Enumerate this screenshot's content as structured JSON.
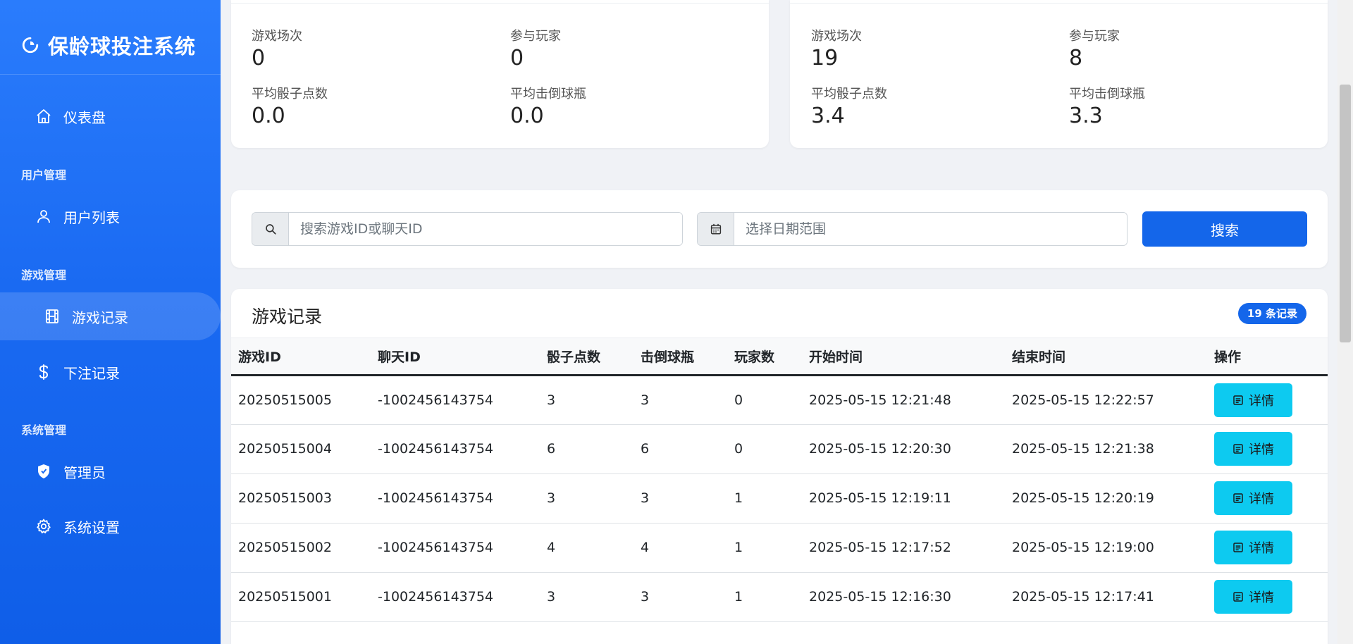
{
  "sidebar": {
    "brand": "保龄球投注系统",
    "items": [
      {
        "label": "仪表盘"
      },
      {
        "label": "用户列表"
      },
      {
        "label": "游戏记录"
      },
      {
        "label": "下注记录"
      },
      {
        "label": "管理员"
      },
      {
        "label": "系统设置"
      }
    ],
    "sections": [
      "用户管理",
      "游戏管理",
      "系统管理"
    ],
    "active_item": "游戏记录"
  },
  "stats": {
    "left": {
      "games_label": "游戏场次",
      "games": "0",
      "players_label": "参与玩家",
      "players": "0",
      "dice_label": "平均骰子点数",
      "dice": "0.0",
      "pins_label": "平均击倒球瓶",
      "pins": "0.0"
    },
    "right": {
      "games_label": "游戏场次",
      "games": "19",
      "players_label": "参与玩家",
      "players": "8",
      "dice_label": "平均骰子点数",
      "dice": "3.4",
      "pins_label": "平均击倒球瓶",
      "pins": "3.3"
    }
  },
  "search": {
    "keyword_placeholder": "搜索游戏ID或聊天ID",
    "date_placeholder": "选择日期范围",
    "button": "搜索"
  },
  "records": {
    "title": "游戏记录",
    "count_badge": "19 条记录",
    "columns": [
      "游戏ID",
      "聊天ID",
      "骰子点数",
      "击倒球瓶",
      "玩家数",
      "开始时间",
      "结束时间",
      "操作"
    ],
    "detail_label": "详情",
    "rows": [
      {
        "game_id": "20250515005",
        "chat_id": "-1002456143754",
        "dice": "3",
        "pins": "3",
        "players": "0",
        "start": "2025-05-15 12:21:48",
        "end": "2025-05-15 12:22:57"
      },
      {
        "game_id": "20250515004",
        "chat_id": "-1002456143754",
        "dice": "6",
        "pins": "6",
        "players": "0",
        "start": "2025-05-15 12:20:30",
        "end": "2025-05-15 12:21:38"
      },
      {
        "game_id": "20250515003",
        "chat_id": "-1002456143754",
        "dice": "3",
        "pins": "3",
        "players": "1",
        "start": "2025-05-15 12:19:11",
        "end": "2025-05-15 12:20:19"
      },
      {
        "game_id": "20250515002",
        "chat_id": "-1002456143754",
        "dice": "4",
        "pins": "4",
        "players": "1",
        "start": "2025-05-15 12:17:52",
        "end": "2025-05-15 12:19:00"
      },
      {
        "game_id": "20250515001",
        "chat_id": "-1002456143754",
        "dice": "3",
        "pins": "3",
        "players": "1",
        "start": "2025-05-15 12:16:30",
        "end": "2025-05-15 12:17:41"
      }
    ]
  }
}
